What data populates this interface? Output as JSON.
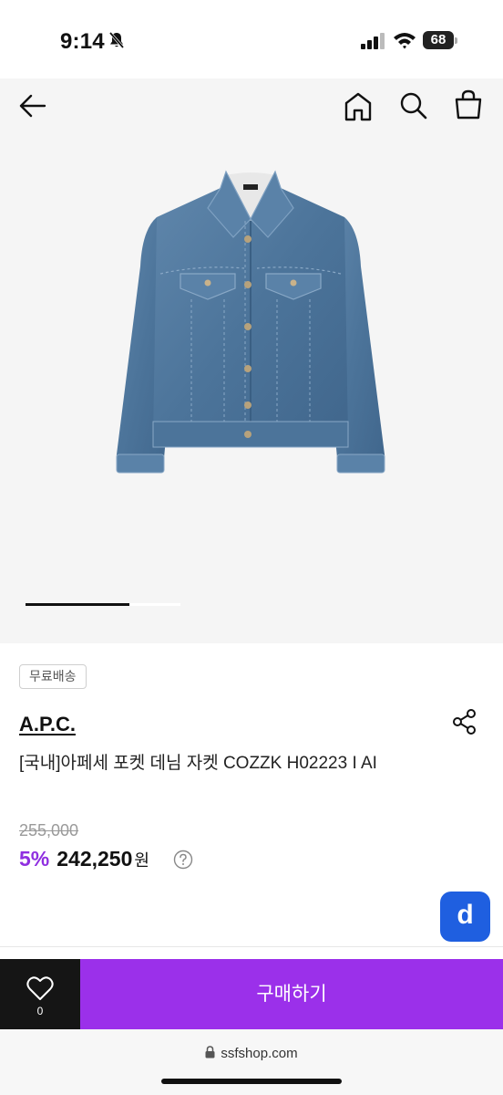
{
  "status_bar": {
    "time": "9:14",
    "battery": "68",
    "icons": [
      "bell-slash-icon",
      "signal-icon",
      "wifi-icon",
      "battery-icon"
    ]
  },
  "header": {
    "icons": [
      "back-arrow-icon",
      "home-icon",
      "search-icon",
      "shopping-bag-icon"
    ]
  },
  "carousel": {
    "progress": 0.67
  },
  "product": {
    "badge": "무료배송",
    "brand": "A.P.C.",
    "name": "[국내]아페세 포켓 데님 자켓 COZZK H02223 I AI",
    "original_price": "255,000",
    "discount": "5%",
    "price": "242,250",
    "currency": "원"
  },
  "floating_app": {
    "label": "d",
    "color": "#1f5fe0"
  },
  "action_bar": {
    "wish_count": "0",
    "buy_label": "구매하기",
    "buy_color": "#9b30ea"
  },
  "browser": {
    "url": "ssfshop.com"
  }
}
